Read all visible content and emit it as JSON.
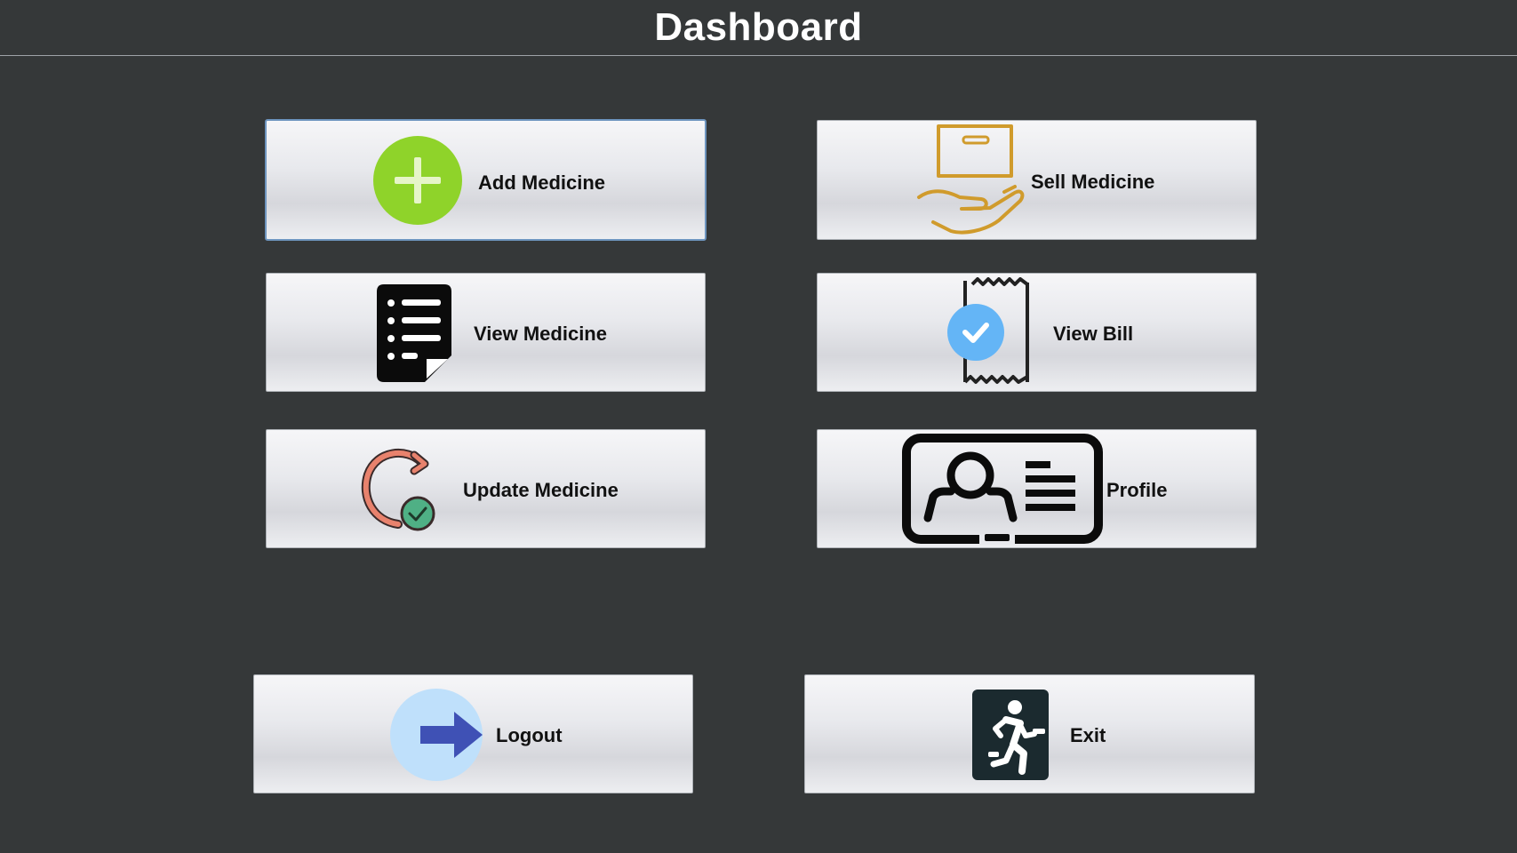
{
  "header": {
    "title": "Dashboard"
  },
  "buttons": {
    "add_medicine": "Add Medicine",
    "sell_medicine": "Sell Medicine",
    "view_medicine": "View Medicine",
    "view_bill": "View Bill",
    "update_medicine": "Update Medicine",
    "profile": "Profile",
    "logout": "Logout",
    "exit": "Exit"
  },
  "icons": {
    "add_medicine": "plus-circle-icon",
    "sell_medicine": "box-in-hand-icon",
    "view_medicine": "document-list-icon",
    "view_bill": "receipt-check-icon",
    "update_medicine": "refresh-check-icon",
    "profile": "id-card-icon",
    "logout": "arrow-right-icon",
    "exit": "running-exit-icon"
  },
  "colors": {
    "background": "#353839",
    "add_icon": "#8fd32a",
    "sell_icon": "#d09b2c",
    "bill_check": "#64b5f6",
    "update_arrow": "#e8826d",
    "update_check": "#4fb085",
    "logout_circle": "#bfe0fb",
    "logout_arrow": "#3f51b5",
    "exit_icon": "#1b2a2f"
  }
}
